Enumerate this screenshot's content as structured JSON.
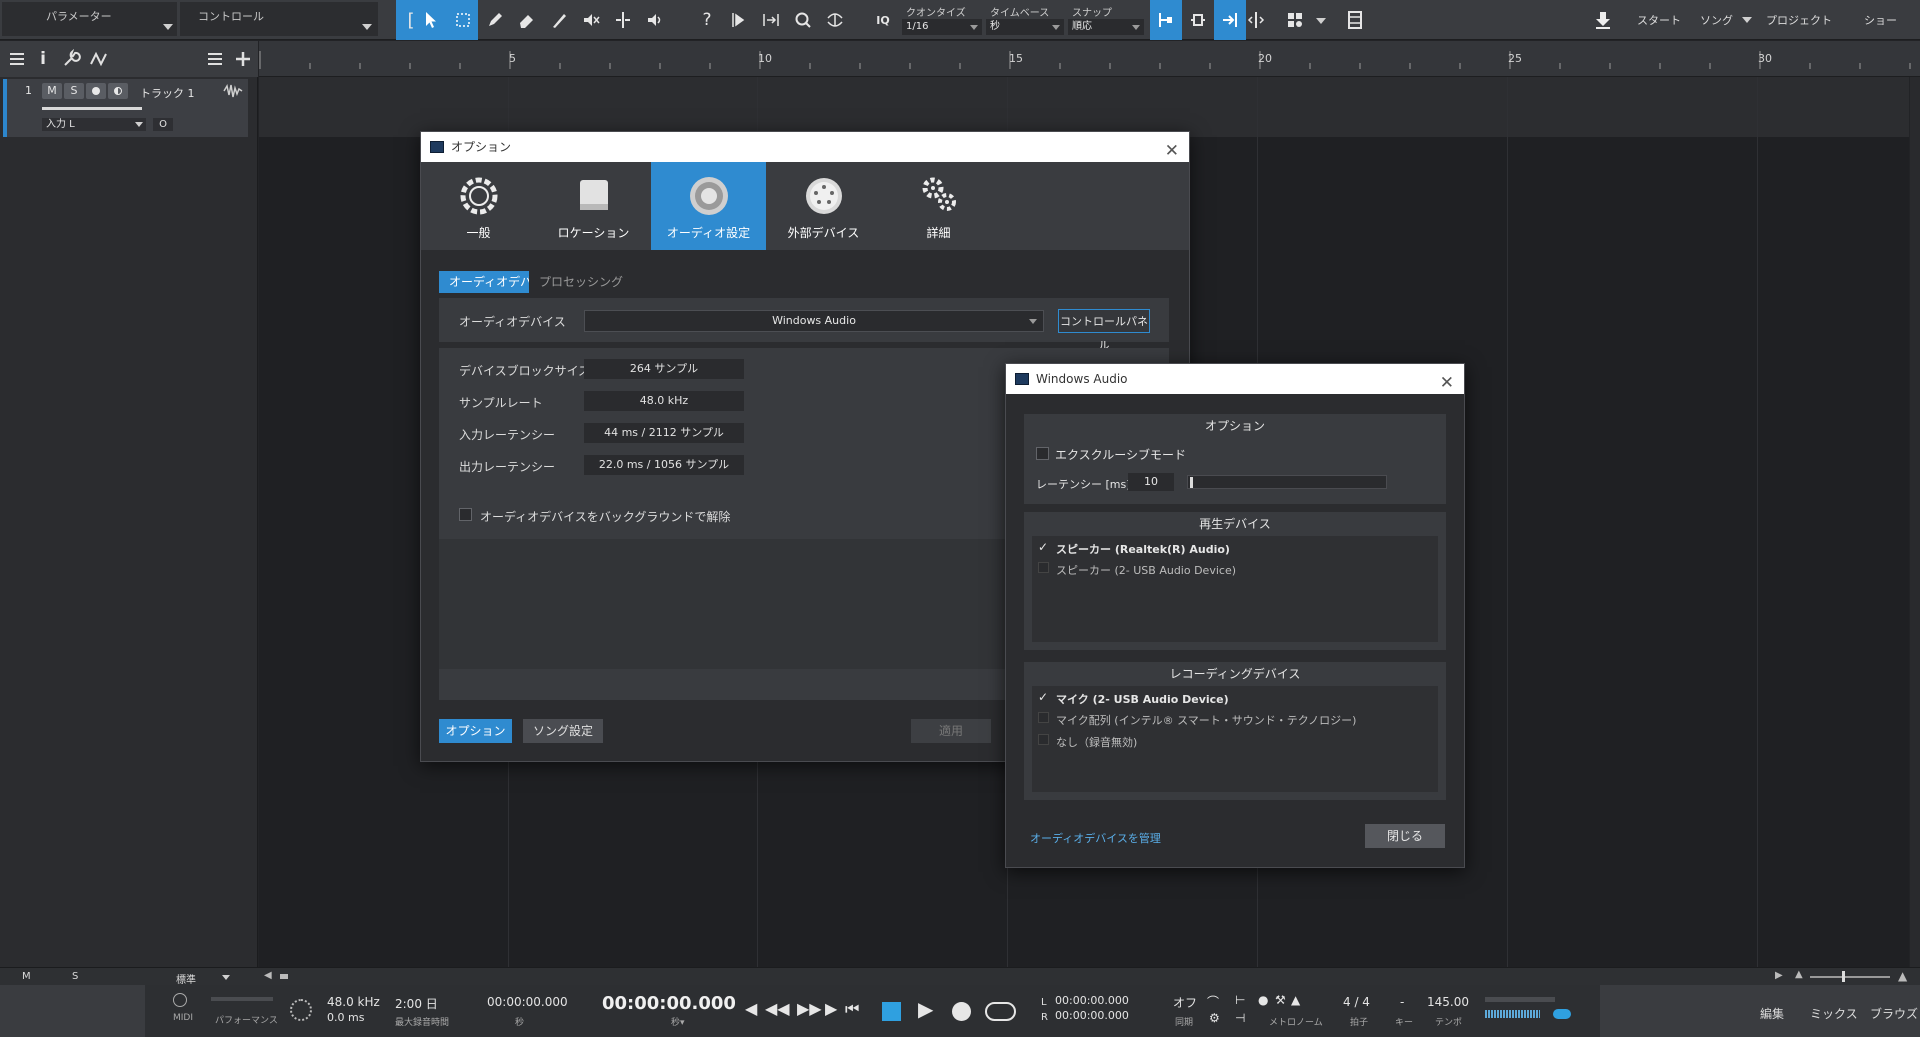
{
  "toolbar": {
    "param_label": "パラメーター",
    "control_label": "コントロール",
    "quantize": {
      "label": "クオンタイズ",
      "value": "1/16"
    },
    "timebase": {
      "label": "タイムベース",
      "value": "秒"
    },
    "snap": {
      "label": "スナップ",
      "value": "順応"
    },
    "nav": {
      "start": "スタート",
      "song": "ソング",
      "project": "プロジェクト",
      "show": "ショー"
    }
  },
  "track": {
    "number": "1",
    "mute": "M",
    "solo": "S",
    "name": "トラック 1",
    "input": "入力 L",
    "monitor": "O"
  },
  "ruler": {
    "marks": [
      "5",
      "10",
      "15",
      "20",
      "25",
      "30"
    ]
  },
  "options_dialog": {
    "title": "オプション",
    "tabs": [
      "一般",
      "ロケーション",
      "オーディオ設定",
      "外部デバイス",
      "詳細"
    ],
    "subtabs": {
      "device": "オーディオデバイス",
      "processing": "プロセッシング"
    },
    "audio_device_label": "オーディオデバイス",
    "audio_device_value": "Windows Audio",
    "control_panel_button": "コントロールパネル",
    "rows": [
      {
        "label": "デバイスブロックサイズ",
        "value": "264 サンプル"
      },
      {
        "label": "サンプルレート",
        "value": "48.0 kHz"
      },
      {
        "label": "入力レーテンシー",
        "value": "44 ms / 2112 サンプル"
      },
      {
        "label": "出力レーテンシー",
        "value": "22.0 ms / 1056 サンプル"
      }
    ],
    "background_release": "オーディオデバイスをバックグラウンドで解除",
    "footer": {
      "options": "オプション",
      "song_settings": "ソング設定",
      "apply": "適用"
    }
  },
  "windows_audio_dialog": {
    "title": "Windows Audio",
    "options_section": "オプション",
    "exclusive_mode": "エクスクルーシブモード",
    "latency_label": "レーテンシー [ms]",
    "latency_value": "10",
    "playback_section": "再生デバイス",
    "playback_devices": [
      {
        "label": "スピーカー (Realtek(R) Audio)",
        "checked": true
      },
      {
        "label": "スピーカー (2- USB Audio Device)",
        "checked": false
      }
    ],
    "recording_section": "レコーディングデバイス",
    "recording_devices": [
      {
        "label": "マイク (2- USB Audio Device)",
        "checked": true
      },
      {
        "label": "マイク配列 (インテル® スマート・サウンド・テクノロジー)",
        "checked": false
      },
      {
        "label": "なし（録音無効)",
        "checked": false
      }
    ],
    "manage_link": "オーディオデバイスを管理",
    "close_button": "閉じる"
  },
  "bottom_strip": {
    "m": "M",
    "s": "S",
    "standard": "標準"
  },
  "transport": {
    "midi": "MIDI",
    "performance": "パフォーマンス",
    "sample_rate": "48.0 kHz",
    "latency": "0.0 ms",
    "record_time": "2:00 日",
    "max_record_label": "最大録音時間",
    "pos_small": "00:00:00.000",
    "sec_label": "秒",
    "pos_main": "00:00:00.000",
    "sec_caret_label": "秒▾",
    "loop_left_label": "L",
    "loop_left": "00:00:00.000",
    "loop_right_label": "R",
    "loop_right": "00:00:00.000",
    "sync_value": "オフ",
    "sync_label": "同期",
    "metronome_label": "メトロノーム",
    "signature": "4 / 4",
    "signature_label": "拍子",
    "key_value": "-",
    "key_label": "キー",
    "tempo": "145.00",
    "tempo_label": "テンポ",
    "nav": {
      "edit": "編集",
      "mix": "ミックス",
      "browse": "ブラウズ"
    }
  },
  "colors": {
    "accent": "#2f8bd0",
    "panel": "#2b2c2f",
    "toolbar": "#3a3c40"
  }
}
